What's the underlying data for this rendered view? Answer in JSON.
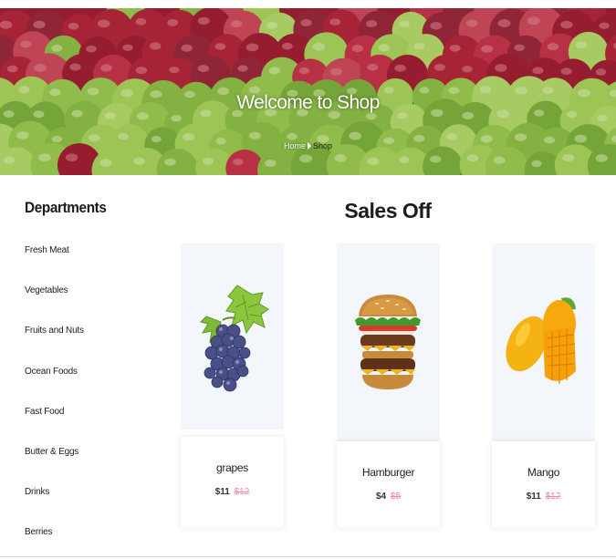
{
  "hero": {
    "title": "Welcome to Shop",
    "breadcrumb": {
      "home": "Home",
      "current": "Shop"
    }
  },
  "sidebar": {
    "heading": "Departments",
    "items": [
      "Fresh Meat",
      "Vegetables",
      "Fruits and Nuts",
      "Ocean Foods",
      "Fast Food",
      "Butter & Eggs",
      "Drinks",
      "Berries"
    ]
  },
  "sales": {
    "title": "Sales Off",
    "products": [
      {
        "name": "grapes",
        "price": "$11",
        "old_price": "$12",
        "icon": "grapes-image"
      },
      {
        "name": "Hamburger",
        "price": "$4",
        "old_price": "$5",
        "icon": "hamburger-image"
      },
      {
        "name": "Mango",
        "price": "$11",
        "old_price": "$12",
        "icon": "mango-image"
      }
    ]
  },
  "colors": {
    "accent_old_price": "#f08ca0",
    "image_bg": "#f3f6fa"
  }
}
